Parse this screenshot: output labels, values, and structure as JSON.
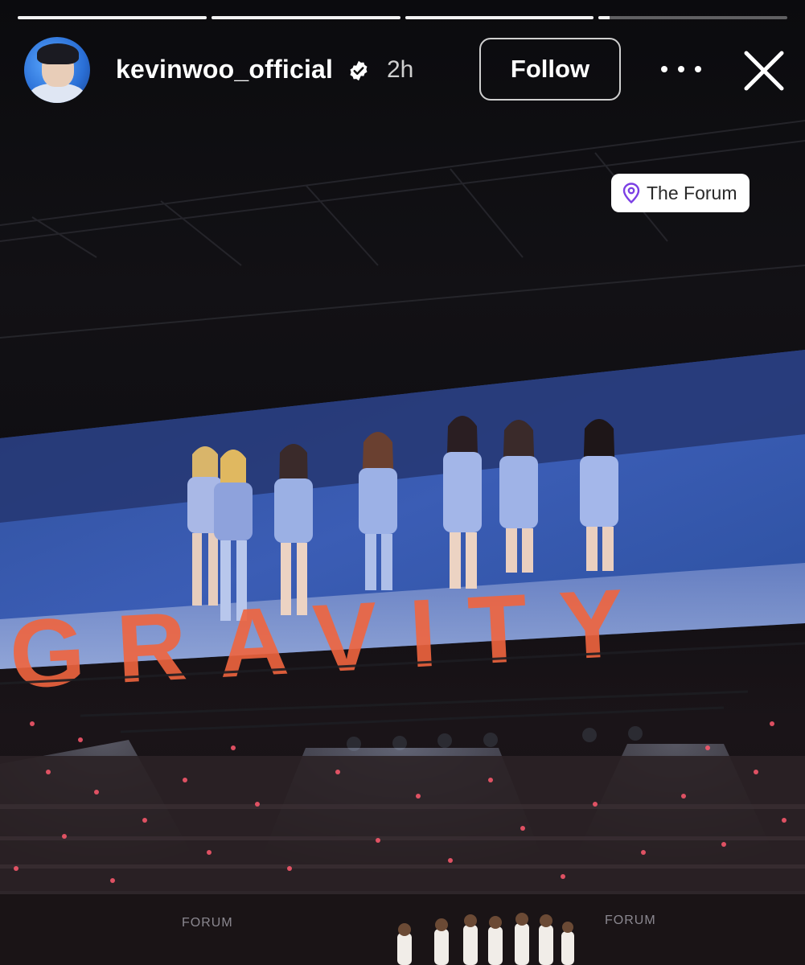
{
  "progress": [
    {
      "fill": 1.0
    },
    {
      "fill": 1.0
    },
    {
      "fill": 1.0
    },
    {
      "fill": 0.06
    }
  ],
  "header": {
    "username": "kevinwoo_official",
    "verified": true,
    "time": "2h",
    "follow_label": "Follow"
  },
  "location": {
    "label": "The Forum",
    "icon": "location-pin-icon",
    "icon_color": "#7b3fe4"
  },
  "photo": {
    "screen_text": "GRAVITY",
    "banner_text_1": "FORUM",
    "banner_text_2": "FORUM"
  }
}
